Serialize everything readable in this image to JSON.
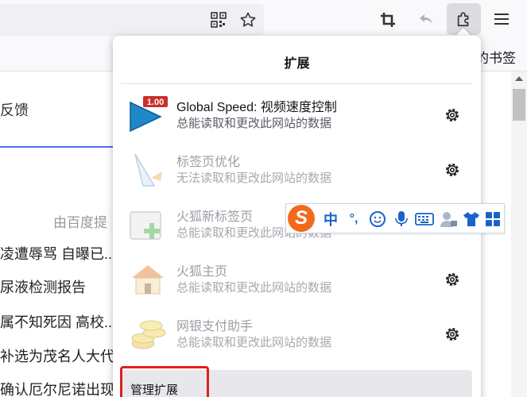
{
  "toolbar": {
    "icons": [
      "qr-code-icon",
      "star-icon",
      "crop-screenshot-icon",
      "undo-icon",
      "extensions-icon",
      "menu-icon"
    ]
  },
  "bookmarks": {
    "text": "的书签"
  },
  "background_page": {
    "feedback": "反馈",
    "source": "由百度提",
    "news": [
      "凌遭辱骂 自曝已..",
      "尿液检测报告",
      "属不知死因 高校..",
      "补选为茂名人大代",
      "确认厄尔尼诺出现"
    ]
  },
  "panel": {
    "title": "扩展",
    "extensions": [
      {
        "name": "Global Speed: 视频速度控制",
        "desc": "总能读取和更改此网站的数据",
        "badge": "1.00",
        "state": "enabled",
        "icon": "play-speed-icon"
      },
      {
        "name": "标签页优化",
        "desc": "无法读取和更改此网站的数据",
        "state": "disabled",
        "icon": "tab-optimize-icon"
      },
      {
        "name": "火狐新标签页",
        "desc": "总能读取和更改此网站的数据",
        "state": "disabled",
        "icon": "new-tab-icon"
      },
      {
        "name": "火狐主页",
        "desc": "总能读取和更改此网站的数据",
        "state": "disabled",
        "icon": "home-icon"
      },
      {
        "name": "网银支付助手",
        "desc": "总能读取和更改此网站的数据",
        "state": "disabled",
        "icon": "coins-icon"
      }
    ],
    "manage_label": "管理扩展"
  },
  "ime": {
    "logo": "S",
    "mode": "中",
    "punct": "°,",
    "icons": [
      "sogou-logo-icon",
      "emoji-icon",
      "microphone-icon",
      "keyboard-icon",
      "user-icon",
      "skin-shirt-icon",
      "toolbox-grid-icon"
    ]
  },
  "colors": {
    "accent": "#4e6ef2",
    "highlight": "#e0201b",
    "ime_blue": "#1a63c7"
  }
}
